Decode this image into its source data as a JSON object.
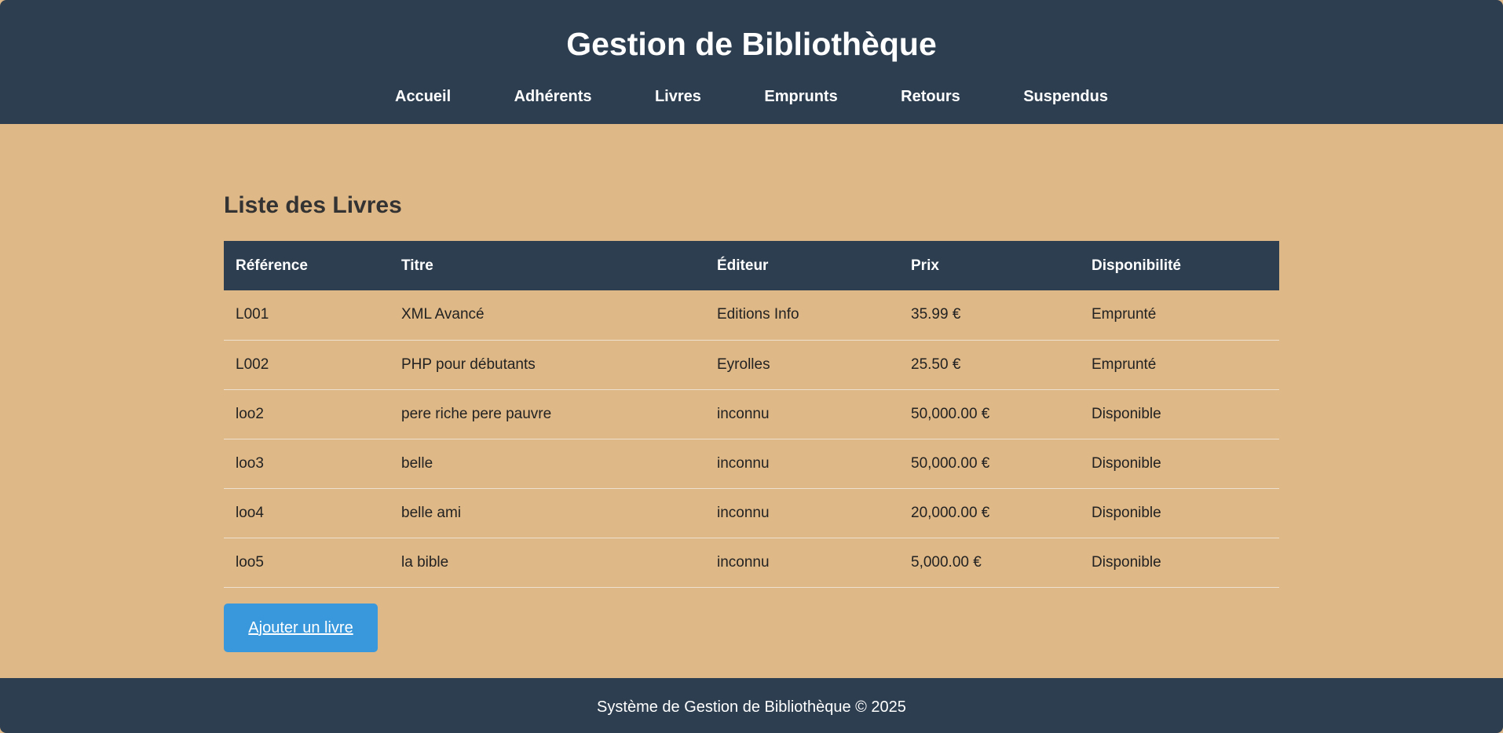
{
  "header": {
    "title": "Gestion de Bibliothèque",
    "nav": [
      "Accueil",
      "Adhérents",
      "Livres",
      "Emprunts",
      "Retours",
      "Suspendus"
    ]
  },
  "main": {
    "section_title": "Liste des Livres",
    "table": {
      "columns": [
        "Référence",
        "Titre",
        "Éditeur",
        "Prix",
        "Disponibilité"
      ],
      "rows": [
        [
          "L001",
          "XML Avancé",
          "Editions Info",
          "35.99 €",
          "Emprunté"
        ],
        [
          "L002",
          "PHP pour débutants",
          "Eyrolles",
          "25.50 €",
          "Emprunté"
        ],
        [
          "loo2",
          "pere riche pere pauvre",
          "inconnu",
          "50,000.00 €",
          "Disponible"
        ],
        [
          "loo3",
          "belle",
          "inconnu",
          "50,000.00 €",
          "Disponible"
        ],
        [
          "loo4",
          "belle ami",
          "inconnu",
          "20,000.00 €",
          "Disponible"
        ],
        [
          "loo5",
          "la bible",
          "inconnu",
          "5,000.00 €",
          "Disponible"
        ]
      ]
    },
    "add_button_label": "Ajouter un livre"
  },
  "footer": {
    "text": "Système de Gestion de Bibliothèque © 2025"
  },
  "colors": {
    "header_bg": "#2d3e50",
    "page_bg": "#dfb887",
    "button_bg": "#3898db"
  }
}
